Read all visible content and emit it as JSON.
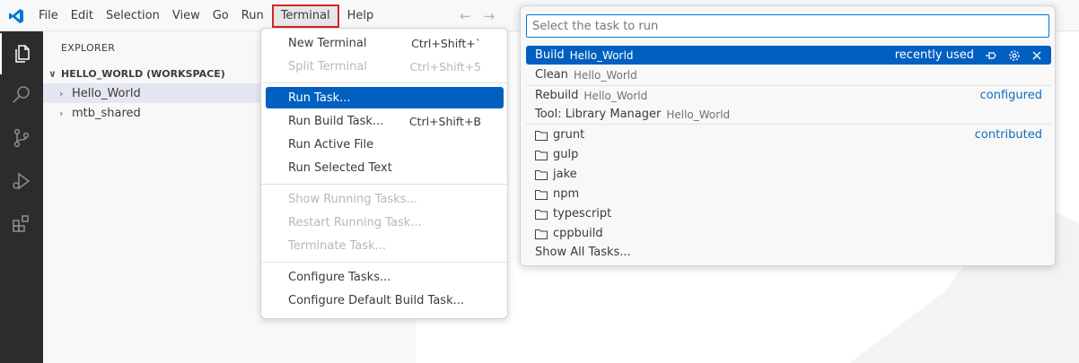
{
  "menubar": {
    "items": [
      "File",
      "Edit",
      "Selection",
      "View",
      "Go",
      "Run",
      "Terminal",
      "Help"
    ],
    "active_index": 6
  },
  "sidebar": {
    "title": "EXPLORER",
    "workspace": "HELLO_WORLD (WORKSPACE)",
    "folders": [
      "Hello_World",
      "mtb_shared"
    ]
  },
  "terminal_menu": {
    "groups": [
      [
        {
          "label": "New Terminal",
          "shortcut": "Ctrl+Shift+`",
          "disabled": false
        },
        {
          "label": "Split Terminal",
          "shortcut": "Ctrl+Shift+5",
          "disabled": true
        }
      ],
      [
        {
          "label": "Run Task...",
          "shortcut": "",
          "disabled": false,
          "highlighted": true
        },
        {
          "label": "Run Build Task...",
          "shortcut": "Ctrl+Shift+B",
          "disabled": false
        },
        {
          "label": "Run Active File",
          "shortcut": "",
          "disabled": false
        },
        {
          "label": "Run Selected Text",
          "shortcut": "",
          "disabled": false
        }
      ],
      [
        {
          "label": "Show Running Tasks...",
          "shortcut": "",
          "disabled": true
        },
        {
          "label": "Restart Running Task...",
          "shortcut": "",
          "disabled": true
        },
        {
          "label": "Terminate Task...",
          "shortcut": "",
          "disabled": true
        }
      ],
      [
        {
          "label": "Configure Tasks...",
          "shortcut": "",
          "disabled": false
        },
        {
          "label": "Configure Default Build Task...",
          "shortcut": "",
          "disabled": false
        }
      ]
    ]
  },
  "quick_pick": {
    "placeholder": "Select the task to run",
    "value": "",
    "highlighted": {
      "label": "Build",
      "desc": "Hello_World",
      "tag": "recently used"
    },
    "recent": [
      {
        "label": "Clean",
        "desc": "Hello_World"
      }
    ],
    "configured_tag": "configured",
    "configured": [
      {
        "label": "Rebuild",
        "desc": "Hello_World"
      },
      {
        "label": "Tool: Library Manager",
        "desc": "Hello_World"
      }
    ],
    "contributed_tag": "contributed",
    "contributed": [
      "grunt",
      "gulp",
      "jake",
      "npm",
      "typescript",
      "cppbuild"
    ],
    "show_all": "Show All Tasks..."
  },
  "colors": {
    "accent": "#0060c0",
    "focus_border": "#0078d4",
    "terminal_outline": "#d6222a",
    "activity_bar": "#2c2c2c"
  },
  "icons": {
    "activity": [
      "explorer-icon",
      "search-icon",
      "source-control-icon",
      "run-debug-icon",
      "extensions-icon"
    ],
    "quick_pick_actions": [
      "pin-icon",
      "gear-icon",
      "close-icon"
    ]
  }
}
